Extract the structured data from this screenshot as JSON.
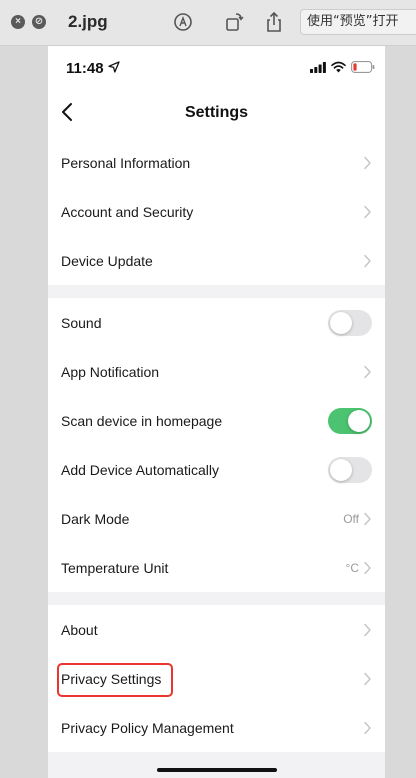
{
  "window": {
    "filename": "2.jpg",
    "open_with_label": "使用“预览”打开"
  },
  "status_bar": {
    "time": "11:48"
  },
  "nav": {
    "title": "Settings"
  },
  "groups": [
    [
      {
        "label": "Personal Information",
        "type": "nav"
      },
      {
        "label": "Account and Security",
        "type": "nav"
      },
      {
        "label": "Device Update",
        "type": "nav"
      }
    ],
    [
      {
        "label": "Sound",
        "type": "toggle",
        "on": false
      },
      {
        "label": "App Notification",
        "type": "nav"
      },
      {
        "label": "Scan device in homepage",
        "type": "toggle",
        "on": true
      },
      {
        "label": "Add Device Automatically",
        "type": "toggle",
        "on": false
      },
      {
        "label": "Dark Mode",
        "type": "nav",
        "value": "Off"
      },
      {
        "label": "Temperature Unit",
        "type": "nav",
        "value": "°C"
      }
    ],
    [
      {
        "label": "About",
        "type": "nav"
      },
      {
        "label": "Privacy Settings",
        "type": "nav",
        "highlighted": true
      },
      {
        "label": "Privacy Policy Management",
        "type": "nav"
      }
    ]
  ],
  "colors": {
    "toggle_on": "#4cc370",
    "highlight_box": "#e8352d",
    "battery_low": "#e53935"
  }
}
